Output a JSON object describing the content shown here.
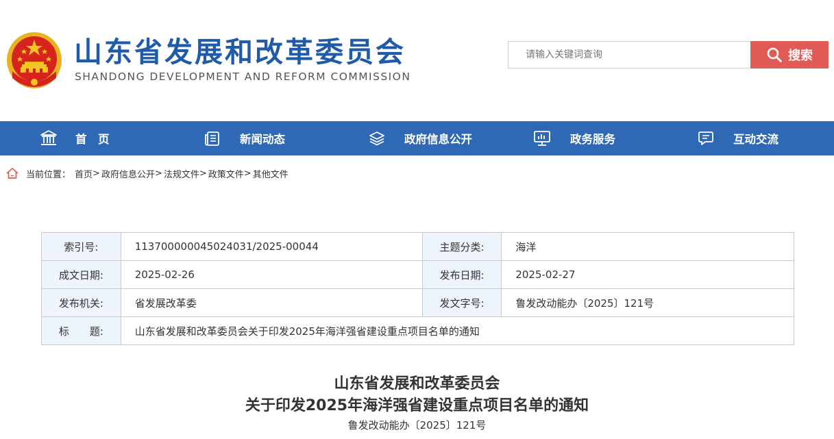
{
  "header": {
    "title": "山东省发展和改革委员会",
    "subtitle": "SHANDONG DEVELOPMENT AND REFORM COMMISSION",
    "logo_icon": "national-emblem-icon"
  },
  "search": {
    "placeholder": "请输入关键词查询",
    "button_label": "搜索",
    "button_color": "#e05a56"
  },
  "nav": {
    "background": "#2f68b4",
    "items": [
      {
        "label": "首　页",
        "icon": "building-icon"
      },
      {
        "label": "新闻动态",
        "icon": "document-list-icon"
      },
      {
        "label": "政府信息公开",
        "icon": "layers-icon"
      },
      {
        "label": "政务服务",
        "icon": "monitor-chart-icon"
      },
      {
        "label": "互动交流",
        "icon": "chat-bubble-icon"
      }
    ]
  },
  "breadcrumb": {
    "prefix": "当前位置：",
    "items": [
      "首页",
      "政府信息公开",
      "法规文件",
      "政策文件",
      "其他文件"
    ],
    "separator": ">"
  },
  "info": {
    "index_label": "索引号:",
    "index_value": "11370000004502403​1/2025-00044",
    "category_label": "主题分类:",
    "category_value": "海洋",
    "created_label": "成文日期:",
    "created_value": "2025-02-26",
    "published_label": "发布日期:",
    "published_value": "2025-02-27",
    "org_label": "发布机关:",
    "org_value": "省发展改革委",
    "docno_label": "发文字号:",
    "docno_value": "鲁发改动能办〔2025〕121号",
    "title_label": "标　　题:",
    "title_value": "山东省发展和改革委员会关于印发2025年海洋强省建设重点项目名单的通知"
  },
  "article": {
    "title_line1": "山东省发展和改革委员会",
    "title_line2": "关于印发2025年海洋强省建设重点项目名单的通知",
    "doc_number": "鲁发改动能办〔2025〕121号"
  }
}
